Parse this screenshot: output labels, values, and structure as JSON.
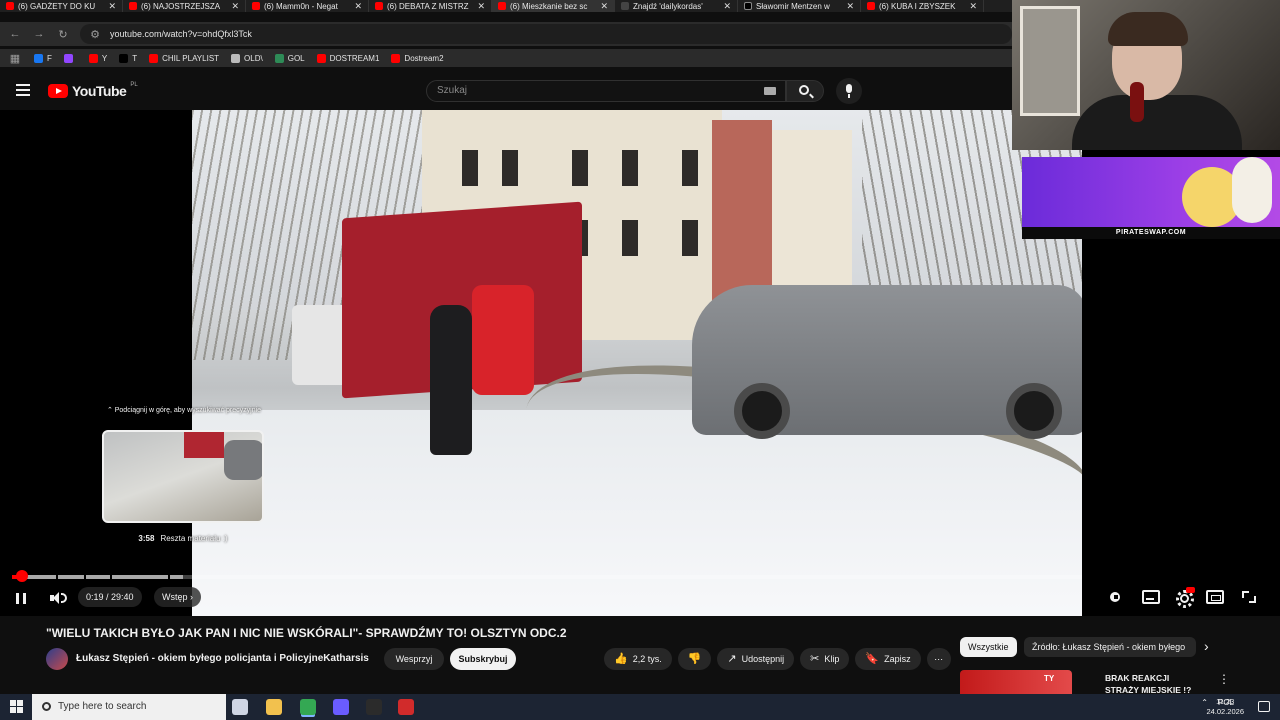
{
  "browser": {
    "tabs": [
      {
        "label": "(6) GADŻETY DO KU",
        "kind": "yt"
      },
      {
        "label": "(6) NAJOSTRZEJSZA",
        "kind": "yt"
      },
      {
        "label": "(6) Mamm0n - Negat",
        "kind": "yt"
      },
      {
        "label": "(6) DEBATA Z MISTRZ",
        "kind": "yt"
      },
      {
        "label": "(6) Mieszkanie bez sc",
        "kind": "yt"
      },
      {
        "label": "Znajdź 'dailykordas'",
        "kind": "kick"
      },
      {
        "label": "Sławomir Mentzen w",
        "kind": "x"
      },
      {
        "label": "(6) KUBA I ZBYSZEK",
        "kind": "yt"
      }
    ],
    "close_glyph": "✕",
    "url": "youtube.com/watch?v=ohdQfxl3Tck",
    "bookmarks": [
      {
        "label": "F",
        "color": "#1877f2"
      },
      {
        "label": "",
        "color": "#9146ff"
      },
      {
        "label": "Y",
        "color": "#ff0000"
      },
      {
        "label": "T",
        "color": "#000000"
      },
      {
        "label": "CHIL PLAYLIST",
        "color": "#ff0000"
      },
      {
        "label": "OLD\\",
        "color": "#bbbbbb"
      },
      {
        "label": "GOL",
        "color": "#2e8b57"
      },
      {
        "label": "DOSTREAM1",
        "color": "#ff0000"
      },
      {
        "label": "Dostream2",
        "color": "#ff0000"
      }
    ]
  },
  "youtube": {
    "logo_word": "YouTube",
    "country_code": "PL",
    "search_placeholder": "Szukaj"
  },
  "player": {
    "seek_hint": "⌃ Podciągnij w górę, aby wyszukiwać precyzyjnie",
    "preview_time": "3:58",
    "preview_chapter": "Reszta materiału :)",
    "time_display": "0:19 / 29:40",
    "chapter_label": "Wstęp",
    "chapter_arrow": "›",
    "played_fraction": 0.0107,
    "buffered_fraction": 0.16
  },
  "overlay": {
    "ad_domain": "PIRATESWAP.COM"
  },
  "video": {
    "title": "\"WIELU TAKICH BYŁO JAK PAN I NIC NIE WSKÓRALI\"- SPRAWDŹMY TO! OLSZTYN ODC.2",
    "channel": "Łukasz Stępień - okiem byłego policjanta i PolicyjneKatharsis",
    "support_label": "Wesprzyj",
    "subscribe_label": "Subskrybuj",
    "actions": [
      {
        "icon": "thumbs-up-icon",
        "glyph": "👍",
        "label": "2,2 tys."
      },
      {
        "icon": "thumbs-down-icon",
        "glyph": "👎",
        "label": ""
      },
      {
        "icon": "share-icon",
        "glyph": "↗",
        "label": "Udostępnij"
      },
      {
        "icon": "clip-icon",
        "glyph": "✂",
        "label": "Klip"
      },
      {
        "icon": "save-icon",
        "glyph": "🔖",
        "label": "Zapisz"
      }
    ],
    "more_glyph": "⋯"
  },
  "recommendations": {
    "chip_all": "Wszystkie",
    "chip_source": "Źródło: Łukasz Stępień - okiem byłego",
    "next_glyph": "›",
    "first_title": "BRAK REAKCJI STRAŻY MIEJSKIE !? Patologia w",
    "first_thumb_badge": "TY",
    "more_glyph": "⋮"
  },
  "taskbar": {
    "search_placeholder": "Type here to search",
    "language": "POL",
    "time": "11:23",
    "date": "24.02.2026",
    "apps": [
      {
        "icon": "task-view-icon",
        "color": "#cfd6e4"
      },
      {
        "icon": "file-explorer-icon",
        "color": "#f2c14e"
      },
      {
        "icon": "chrome-icon",
        "color": "#34a853"
      },
      {
        "icon": "messenger-icon",
        "color": "#6a5cff"
      },
      {
        "icon": "obs-icon",
        "color": "#2b2b2b"
      },
      {
        "icon": "record-app-icon",
        "color": "#d12b2b"
      }
    ]
  },
  "colors": {
    "accent_red": "#ff0000",
    "background": "#0f0f0f"
  }
}
